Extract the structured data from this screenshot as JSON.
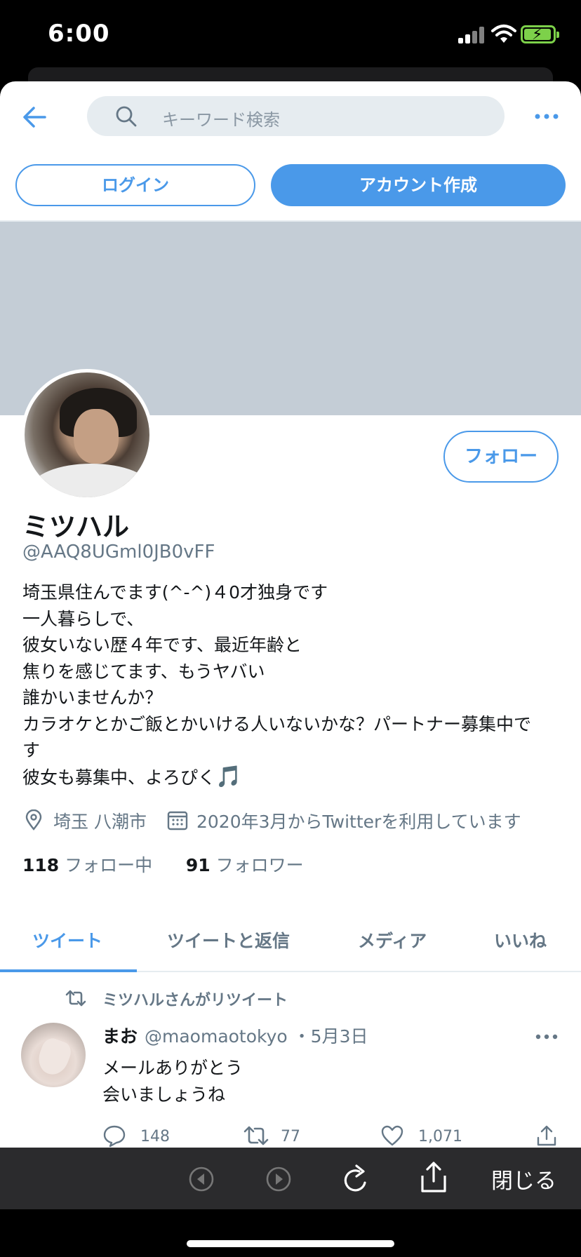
{
  "status_bar": {
    "time": "6:00"
  },
  "topbar": {
    "search_placeholder": "キーワード検索"
  },
  "auth_buttons": {
    "login": "ログイン",
    "signup": "アカウント作成"
  },
  "profile": {
    "follow_label": "フォロー",
    "display_name": "ミツハル",
    "handle": "@AAQ8UGml0JB0vFF",
    "bio_lines": [
      "埼玉県住んでます(^-^)４0才独身です",
      "一人暮らしで、",
      "彼女いない歴４年です、最近年齢と",
      "焦りを感じてます、もうヤバい",
      "誰かいませんか？",
      "カラオケとかご飯とかいける人いないかな？パートナー募集中で",
      "す",
      "彼女も募集中、よろぴく"
    ],
    "bio_emoji": "🎵",
    "location": "埼玉 八潮市",
    "joined": "2020年3月からTwitterを利用しています",
    "following_count": "118",
    "following_label": "フォロー中",
    "followers_count": "91",
    "followers_label": "フォロワー"
  },
  "tabs": [
    {
      "label": "ツイート",
      "active": true
    },
    {
      "label": "ツイートと返信",
      "active": false
    },
    {
      "label": "メディア",
      "active": false
    },
    {
      "label": "いいね",
      "active": false
    }
  ],
  "tweet": {
    "retweet_label": "ミツハルさんがリツイート",
    "author_name": "まお",
    "author_handle": "@maomaotokyo",
    "date": "・5月3日",
    "text_lines": [
      "メールありがとう",
      "会いましょうね"
    ],
    "replies": "148",
    "retweets": "77",
    "likes": "1,071"
  },
  "browser_bar": {
    "close_label": "閉じる"
  },
  "colors": {
    "accent": "#4a99e9",
    "muted": "#657786",
    "banner": "#c4cdd6"
  }
}
